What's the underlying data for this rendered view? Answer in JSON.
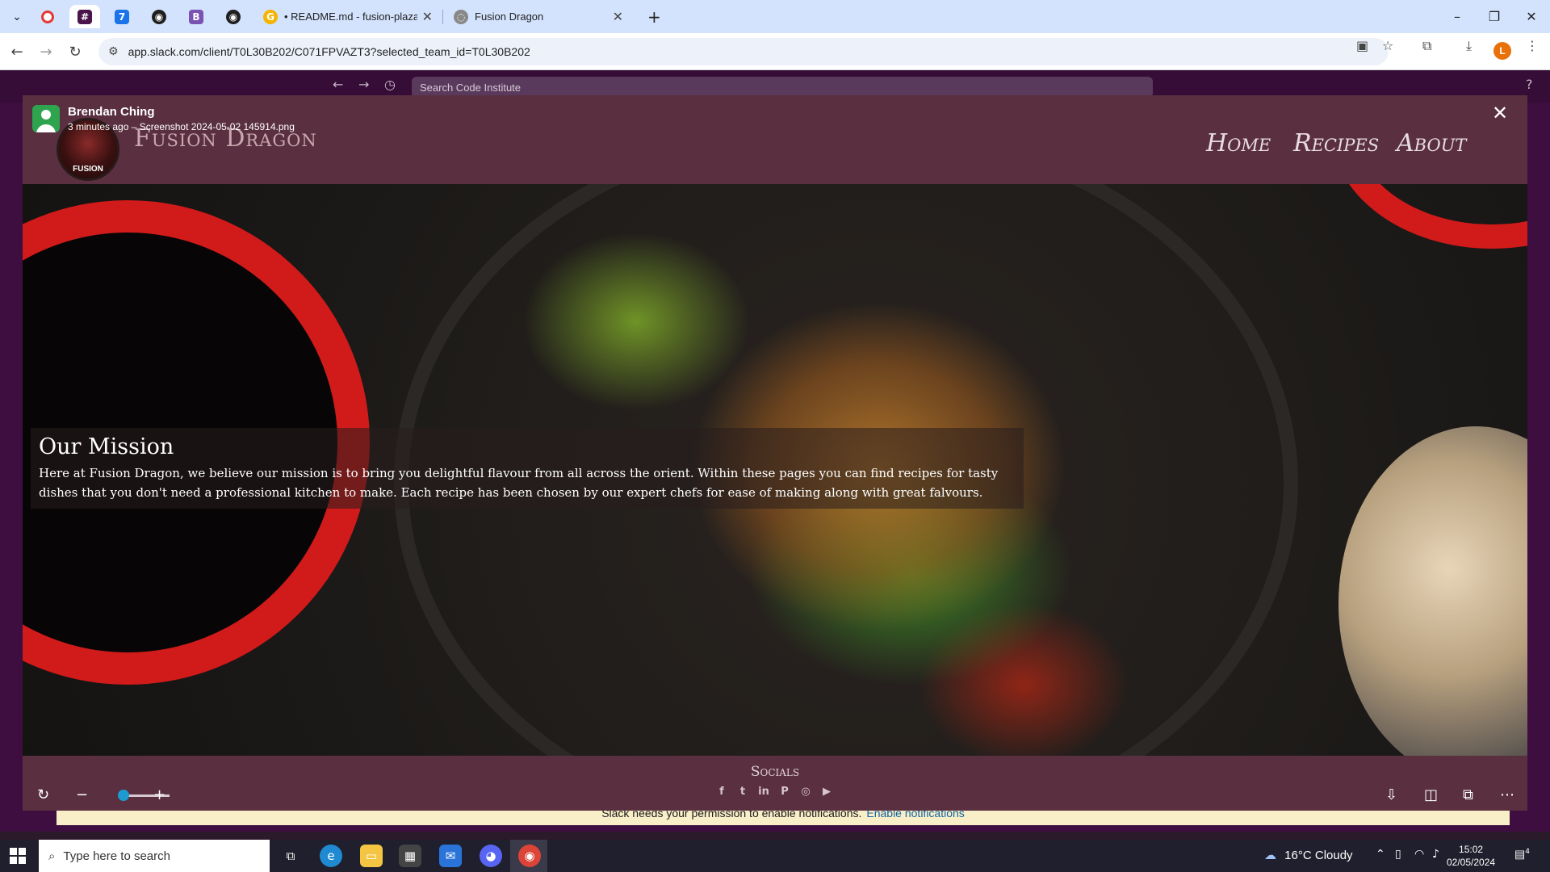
{
  "browser": {
    "tabs": [
      {
        "title": "• README.md - fusion-plaza -",
        "icon": "google-g-icon"
      },
      {
        "title": "Fusion Dragon",
        "icon": "globe-icon"
      }
    ],
    "pinned_tabs": [
      "opera-icon",
      "slack-icon",
      "calendar-icon",
      "github-icon",
      "bootstrap-icon",
      "github-icon"
    ],
    "new_tab": "+",
    "url": "app.slack.com/client/T0L30B202/C071FPVAZT3?selected_team_id=T0L30B202",
    "profile_initial": "L"
  },
  "slack": {
    "search_placeholder": "Search Code Institute",
    "notification_text": "Slack needs your permission to enable notifications.",
    "notification_link": "Enable notifications"
  },
  "lightbox": {
    "uploader": "Brendan Ching",
    "meta": "3 minutes ago – Screenshot 2024-05-02 145914.png",
    "close": "✕"
  },
  "site": {
    "logo_text": "FUSION",
    "name": "Fusion Dragon",
    "nav": [
      "Home",
      "Recipes",
      "About"
    ],
    "mission_title": "Our Mission",
    "mission_text": "Here at Fusion Dragon, we believe our mission is to bring you delightful flavour from all across the orient. Within these pages you can find recipes for tasty dishes that you don't need a professional kitchen to make. Each recipe has been chosen by our expert chefs for ease of making along with great falvours.",
    "socials_title": "Socials",
    "social_icons": [
      "facebook-icon",
      "twitter-icon",
      "linkedin-icon",
      "pinterest-icon",
      "instagram-icon",
      "youtube-icon"
    ]
  },
  "taskbar": {
    "search_placeholder": "Type here to search",
    "weather": "16°C  Cloudy",
    "time": "15:02",
    "date": "02/05/2024",
    "notification_count": "4"
  },
  "colors": {
    "chrome_tabstrip": "#d3e3fd",
    "slack_purple": "#3f0e40",
    "site_header": "#5a3040",
    "accent_blue": "#1d9bd1"
  }
}
